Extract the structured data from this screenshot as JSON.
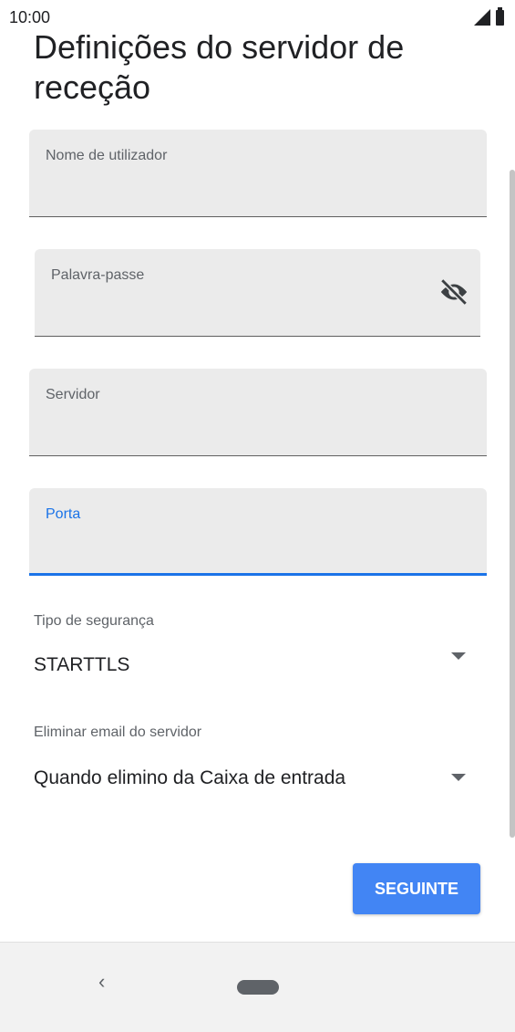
{
  "status_bar": {
    "time": "10:00"
  },
  "page": {
    "title": "Definições do servidor de receção"
  },
  "fields": {
    "username": {
      "label": "Nome de utilizador",
      "value": ""
    },
    "password": {
      "label": "Palavra-passe",
      "value": ""
    },
    "server": {
      "label": "Servidor",
      "value": ""
    },
    "port": {
      "label": "Porta",
      "value": ""
    }
  },
  "security": {
    "label": "Tipo de segurança",
    "value": "STARTTLS"
  },
  "delete_email": {
    "label": "Eliminar email do servidor",
    "value": "Quando elimino da Caixa de entrada"
  },
  "actions": {
    "next_label": "SEGUINTE"
  },
  "nav": {
    "back_symbol": "‹"
  },
  "icons": [
    "visibility-off-icon",
    "dropdown-arrow-icon",
    "signal-icon",
    "battery-icon",
    "back-icon",
    "home-icon"
  ],
  "colors": {
    "accent": "#1a73e8",
    "button": "#4285f4",
    "field_bg": "#ebebeb"
  }
}
